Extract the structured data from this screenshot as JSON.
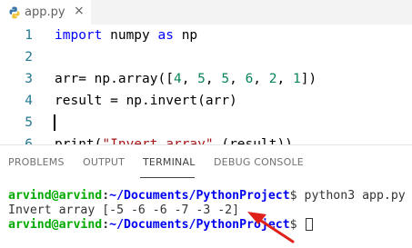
{
  "tab": {
    "filename": "app.py",
    "close_glyph": "×",
    "icon": "python-icon"
  },
  "editor": {
    "lines": [
      {
        "number": "1",
        "tokens": [
          {
            "t": "import",
            "c": "kw"
          },
          {
            "t": " numpy ",
            "c": ""
          },
          {
            "t": "as",
            "c": "kw"
          },
          {
            "t": " np",
            "c": ""
          }
        ]
      },
      {
        "number": "2",
        "tokens": []
      },
      {
        "number": "3",
        "tokens": [
          {
            "t": "arr= np.array([",
            "c": ""
          },
          {
            "t": "4",
            "c": "num"
          },
          {
            "t": ", ",
            "c": ""
          },
          {
            "t": "5",
            "c": "num"
          },
          {
            "t": ", ",
            "c": ""
          },
          {
            "t": "5",
            "c": "num"
          },
          {
            "t": ", ",
            "c": ""
          },
          {
            "t": "6",
            "c": "num"
          },
          {
            "t": ", ",
            "c": ""
          },
          {
            "t": "2",
            "c": "num"
          },
          {
            "t": ", ",
            "c": ""
          },
          {
            "t": "1",
            "c": "num"
          },
          {
            "t": "])",
            "c": ""
          }
        ]
      },
      {
        "number": "4",
        "tokens": [
          {
            "t": "result = np.invert(arr)",
            "c": ""
          }
        ]
      },
      {
        "number": "5",
        "tokens": [],
        "cursor": true
      },
      {
        "number": "6",
        "tokens": [
          {
            "t": "print(",
            "c": ""
          },
          {
            "t": "\"Invert array\"",
            "c": "str"
          },
          {
            "t": ",(result))",
            "c": ""
          }
        ]
      }
    ]
  },
  "panel": {
    "tabs": [
      {
        "label": "PROBLEMS",
        "active": false
      },
      {
        "label": "OUTPUT",
        "active": false
      },
      {
        "label": "TERMINAL",
        "active": true
      },
      {
        "label": "DEBUG CONSOLE",
        "active": false
      }
    ]
  },
  "terminal": {
    "user_host": "arvind@arvind",
    "colon": ":",
    "path": "~/Documents/PythonProject",
    "command_line": "$ python3 app.py",
    "output_line": "Invert array [-5 -6 -6 -7 -3 -2]",
    "prompt_end": "$ ",
    "colors": {
      "user": "#00aa00",
      "path": "#0000ee",
      "arrow": "#e0201a"
    }
  }
}
